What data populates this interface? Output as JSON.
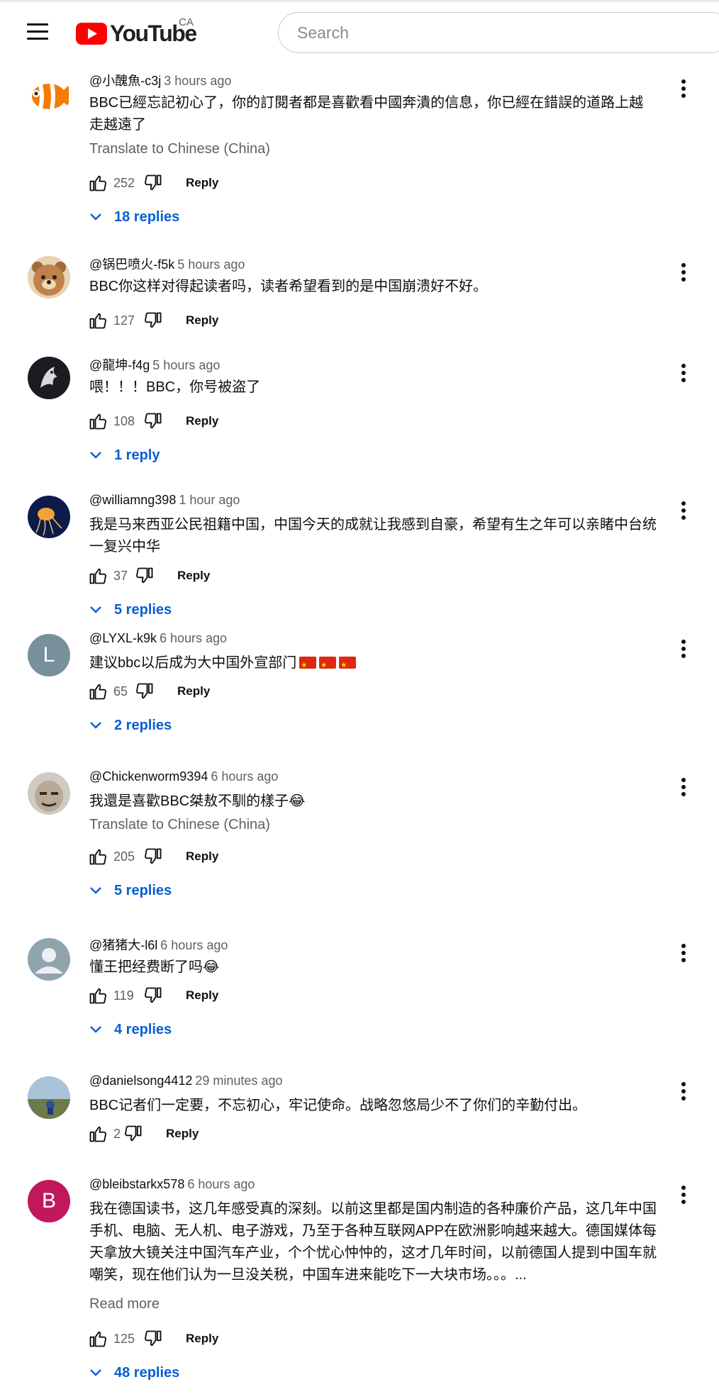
{
  "header": {
    "logo_text": "YouTube",
    "region": "CA",
    "search_placeholder": "Search",
    "brand_color": "#ff0000"
  },
  "comments": [
    {
      "author": "@小醜魚-c3j",
      "time": "3 hours ago",
      "text": "BBC已經忘記初心了，你的訂閱者都是喜歡看中國奔潰的信息，你已經在錯誤的道路上越走越遠了",
      "translate": "Translate to Chinese (China)",
      "likes": "252",
      "reply_label": "Reply",
      "replies": "18 replies",
      "avatar": "clownfish"
    },
    {
      "author": "@锅巴喷火-f5k",
      "time": "5 hours ago",
      "text": "BBC你这样对得起读者吗，读者希望看到的是中国崩溃好不好。",
      "likes": "127",
      "reply_label": "Reply",
      "avatar": "bear"
    },
    {
      "author": "@龍坤-f4g",
      "time": "5 hours ago",
      "text": "喂！！！BBC，你号被盗了",
      "likes": "108",
      "reply_label": "Reply",
      "replies": "1 reply",
      "avatar": "dragon"
    },
    {
      "author": "@williamng398",
      "time": "1 hour ago",
      "text": "我是马来西亚公民祖籍中国，中国今天的成就让我感到自豪，希望有生之年可以亲睹中台统一复兴中华",
      "likes": "37",
      "reply_label": "Reply",
      "replies": "5 replies",
      "avatar": "jellyfish"
    },
    {
      "author": "@LYXL-k9k",
      "time": "6 hours ago",
      "text": "建议bbc以后成为大中国外宣部门",
      "flags": "🇨🇳🇨🇳🇨🇳",
      "likes": "65",
      "reply_label": "Reply",
      "replies": "2 replies",
      "avatar_letter": "L",
      "avatar_color": "#78909c"
    },
    {
      "author": "@Chickenworm9394",
      "time": "6 hours ago",
      "text": "我還是喜歡BBC桀敖不馴的樣子😂",
      "translate": "Translate to Chinese (China)",
      "likes": "205",
      "reply_label": "Reply",
      "replies": "5 replies",
      "avatar": "face"
    },
    {
      "author": "@猪猪大-l6l",
      "time": "6 hours ago",
      "text": "懂王把经费断了吗😂",
      "likes": "119",
      "reply_label": "Reply",
      "replies": "4 replies",
      "avatar": "default-user"
    },
    {
      "author": "@danielsong4412",
      "time": "29 minutes ago",
      "text": "BBC记者们一定要，不忘初心，牢记使命。战略忽悠局少不了你们的辛勤付出。",
      "likes": "2",
      "reply_label": "Reply",
      "avatar": "landscape"
    },
    {
      "author": "@bleibstarkx578",
      "time": "6 hours ago",
      "text": "我在德国读书，这几年感受真的深刻。以前这里都是国内制造的各种廉价产品，这几年中国手机、电脑、无人机、电子游戏，乃至于各种互联网APP在欧洲影响越来越大。德国媒体每天拿放大镜关注中国汽车产业，个个忧心忡忡的，这才几年时间，以前德国人提到中国车就嘲笑，现在他们认为一旦没关税，中国车进来能吃下一大块市场。。。...",
      "read_more": "Read more",
      "likes": "125",
      "reply_label": "Reply",
      "replies": "48 replies",
      "avatar_letter": "B",
      "avatar_color": "#c2185b"
    }
  ]
}
